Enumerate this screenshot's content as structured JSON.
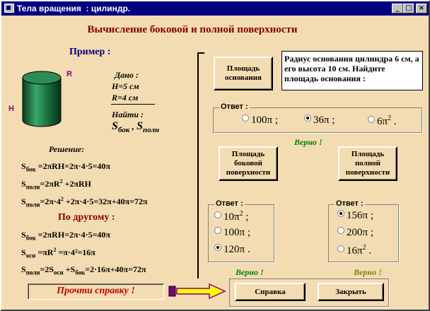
{
  "window": {
    "title": "Тела вращения  : цилиндр.",
    "buttons": {
      "minimize": "_",
      "maximize": "□",
      "close": "×"
    }
  },
  "heading": "Вычисление боковой и полной поверхности",
  "left": {
    "example_label": "Пример :",
    "figure_labels": {
      "r": "R",
      "h": "H"
    },
    "given": {
      "title": "Дано :",
      "h": "H=5 см",
      "r": "R=4 см",
      "find_title": "Найти :",
      "find_s1": "S",
      "find_s1_sub": "бок",
      "find_sep": " , ",
      "find_s2": "S",
      "find_s2_sub": "полн"
    },
    "solution_label": "Решение:",
    "sol": {
      "l1_s": "S",
      "l1_sub": "бок",
      "l1_expr": " =2πRH=2π·4·5=40π",
      "l2_s": "S",
      "l2_sub": "полн",
      "l2_a": "=2πR",
      "l2_sup": "2",
      "l2_b": " +2πRH",
      "l3_s": "S",
      "l3_sub": "полн",
      "l3_a": "=2π·4",
      "l3_sup": "2",
      "l3_b": " +2π·4·5=32π+40π=72π"
    },
    "other_label": "По другому :",
    "alt": {
      "l1_s": "S",
      "l1_sub": "бок",
      "l1_expr": " =2πRH=2π·4·5=40π",
      "l2_s": "S",
      "l2_sub": "осн",
      "l2_a": " =πR",
      "l2_sup": "2",
      "l2_b": " =π·4²=16π",
      "l3_s": "S",
      "l3_sub": "полн",
      "l3_a": "=2S",
      "l3_sub2": "осн",
      "l3_b": " +S",
      "l3_sub3": "бок",
      "l3_c": "=2·16π+40π=72π"
    }
  },
  "right": {
    "base_area_button": "Площадь основания",
    "problem_text": "Радиус основания цилиндра 6 см, а его высота 10 см. Найдите площадь основания :",
    "answer1": {
      "legend": "Ответ :",
      "options": [
        {
          "text": "100π  ;",
          "checked": false
        },
        {
          "text": "36π  ;",
          "checked": true
        },
        {
          "text": "6π",
          "sup": "2",
          "tail": " .",
          "checked": false
        }
      ]
    },
    "verno1": "Верно !",
    "lateral_button": "Площадь боковой поверхности",
    "total_button": "Площадь полной поверхности",
    "answer2": {
      "legend": "Ответ :",
      "options": [
        {
          "text": "10π",
          "sup": "2",
          "tail": "  ;",
          "checked": false
        },
        {
          "text": "100π  ;",
          "checked": false
        },
        {
          "text": "120π  .",
          "checked": true
        }
      ]
    },
    "answer3": {
      "legend": "Ответ :",
      "options": [
        {
          "text": "156π  ;",
          "checked": true
        },
        {
          "text": "200π  ;",
          "checked": false
        },
        {
          "text": "16π",
          "sup": "2",
          "tail": "  .",
          "checked": false
        }
      ]
    },
    "verno2": "Верно !",
    "verno3": "Верно !"
  },
  "bottom": {
    "help_text": "Прочти справку !",
    "help_button": "Справка",
    "close_button": "Закрыть"
  },
  "colors": {
    "background": "#f4dcb2",
    "title_bar": "#000080",
    "heading": "#800000",
    "example": "#000080",
    "verno_green": "#008000",
    "verno_olive": "#808000",
    "help_text": "#c00000",
    "arrow": "#ffff00"
  }
}
